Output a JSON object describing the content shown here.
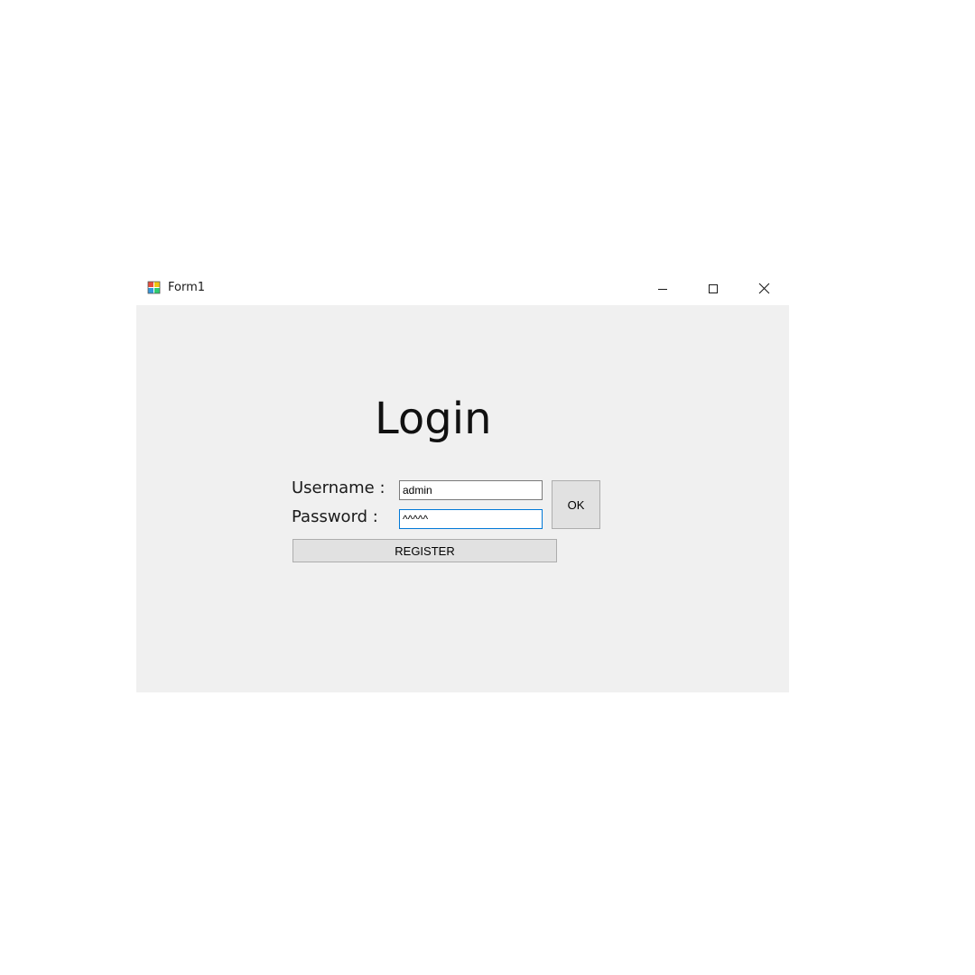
{
  "window": {
    "title": "Form1",
    "controls": {
      "minimize_icon": "minimize-icon",
      "maximize_icon": "maximize-icon",
      "close_icon": "close-icon"
    }
  },
  "form": {
    "heading": "Login",
    "username_label": "Username :",
    "username_value": "admin",
    "password_label": "Password :",
    "password_value": "^^^^^",
    "ok_label": "OK",
    "register_label": "REGISTER"
  },
  "colors": {
    "client_bg": "#f0f0f0",
    "focus_border": "#0078d7"
  }
}
